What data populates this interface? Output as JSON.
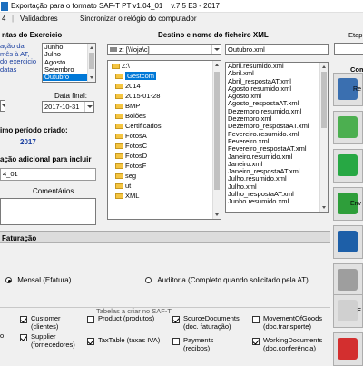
{
  "window": {
    "title": "Exportação para o formato SAF-T PT v1.04_01",
    "version": "v.7.5 E3 - 2017"
  },
  "menu": {
    "items": [
      "4",
      "Validadores",
      "Sincronizar o relógio do computador"
    ]
  },
  "left_panel": {
    "months_heading": "ntas do Exercicio",
    "info_lines": [
      "ação da",
      "mês à AT,",
      "do exercicio",
      "datas"
    ],
    "months": [
      "Junho",
      "Julho",
      "Agosto",
      "Setembro",
      "Outubro"
    ],
    "selected_month": "Outubro",
    "date_final_label": "Data final:",
    "date_final_value": "2017-10-31",
    "last_period_heading": "imo período criado:",
    "last_period_value": "2017",
    "info_add_heading": "ação adicional para incluir",
    "version_value": "4_01",
    "comments_label": "Comentários"
  },
  "center_panel": {
    "heading": "Destino e nome do ficheiro XML",
    "drive": "z: [\\\\loja\\c]",
    "filename": "Outubro.xml",
    "folders": [
      "Z:\\",
      "Gestcom",
      "2014",
      "2015-01-28",
      "BMP",
      "Bolões",
      "Certificados",
      "FotosA",
      "FotosC",
      "FotosD",
      "FotosF",
      "seg",
      "ut",
      "XML"
    ],
    "selected_folder": "Gestcom",
    "files": [
      "Abril.resumido.xml",
      "Abril.xml",
      "Abril_respostaAT.xml",
      "Agosto.resumido.xml",
      "Agosto.xml",
      "Agosto_respostaAT.xml",
      "Dezembro.resumido.xml",
      "Dezembro.xml",
      "Dezembro_respostaAT.xml",
      "Fevereiro.resumido.xml",
      "Fevereiro.xml",
      "Fevereiro_respostaAT.xml",
      "Janeiro.resumido.xml",
      "Janeiro.xml",
      "Janeiro_respostaAT.xml",
      "Julho.resumido.xml",
      "Julho.xml",
      "Julho_respostaAT.xml",
      "Junho.resumido.xml"
    ]
  },
  "right_panel": {
    "heading": "Etap",
    "sub_heading": "Com",
    "buttons": [
      {
        "name": "report",
        "label": "Re",
        "color": "#3a6fb0"
      },
      {
        "name": "validate",
        "label": "",
        "color": "#4caf50"
      },
      {
        "name": "disk",
        "label": "",
        "color": "#27a844"
      },
      {
        "name": "send",
        "label": "Env",
        "sublabel": "p",
        "color": "#2e9e3a"
      },
      {
        "name": "efatura",
        "label": "",
        "color": "#1d5fa8"
      },
      {
        "name": "user",
        "label": "",
        "color": "#9e9e9e"
      },
      {
        "name": "edit",
        "label": "E",
        "color": "#d0d0d0"
      },
      {
        "name": "close",
        "label": "",
        "color": "#d32f2f"
      }
    ]
  },
  "faturacao": {
    "tab_label": "Faturação",
    "radio_mensal": "Mensal (Efatura)",
    "radio_auditoria": "Auditoria (Completo quando solicitado pela AT)",
    "selected": "mensal"
  },
  "tables": {
    "heading": "Tabelas a criar no SAF-T",
    "items": [
      {
        "label": "Customer\n(clientes)",
        "checked": true
      },
      {
        "label": "Supplier\n(fornecedores)",
        "checked": true
      },
      {
        "label": "Product (produtos)",
        "checked": false
      },
      {
        "label": "TaxTable (taxas IVA)",
        "checked": true
      },
      {
        "label": "SourceDocuments\n(doc. faturação)",
        "checked": true
      },
      {
        "label": "Payments\n(recibos)",
        "checked": false
      },
      {
        "label": "MovementOfGoods\n(doc.transporte)",
        "checked": false
      },
      {
        "label": "WorkingDocuments\n(doc.conferência)",
        "checked": true
      }
    ],
    "partial_label": "o"
  }
}
